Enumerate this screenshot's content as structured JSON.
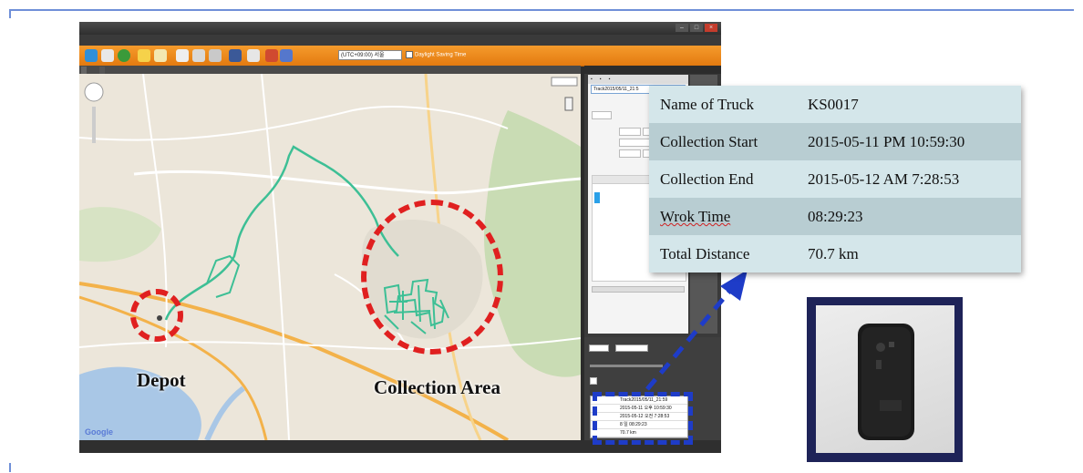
{
  "app": {
    "title": "",
    "menu": [
      "",
      "",
      "",
      "",
      "",
      "",
      ""
    ],
    "timezone": "(UTC+09:00) 서울",
    "dst_label": "Daylight Saving Time",
    "tabs": [
      "",
      ""
    ],
    "status_right": ""
  },
  "side_panel": {
    "tabs": "",
    "track_row": "Track2015/05/11_21:5",
    "info_rows": [
      {
        "k": "",
        "v": "Track2015/05/11_21:59"
      },
      {
        "k": "",
        "v": "2015-05-11 오후 10:59:30"
      },
      {
        "k": "",
        "v": "2015-05-12 오전 7:28:53"
      },
      {
        "k": "",
        "v": "8 일 08:29:23"
      },
      {
        "k": "",
        "v": "70.7 km"
      }
    ]
  },
  "labels": {
    "depot": "Depot",
    "collection_area": "Collection Area"
  },
  "callout": {
    "rows": [
      {
        "key": "Name of Truck",
        "value": "KS0017"
      },
      {
        "key": "Collection Start",
        "value": "2015-05-11 PM 10:59:30"
      },
      {
        "key": "Collection End",
        "value": "2015-05-12 AM 7:28:53"
      },
      {
        "key": "Wrok Time",
        "value": "08:29:23"
      },
      {
        "key": "Total Distance",
        "value": "70.7 km"
      }
    ]
  },
  "map": {
    "google_mark": "Google"
  },
  "colors": {
    "route": "#3dbf95",
    "circle": "#e02020",
    "highlight_box": "#1e3cc8",
    "toolbar": "#f08a1e",
    "device_frame": "#1e2358"
  }
}
